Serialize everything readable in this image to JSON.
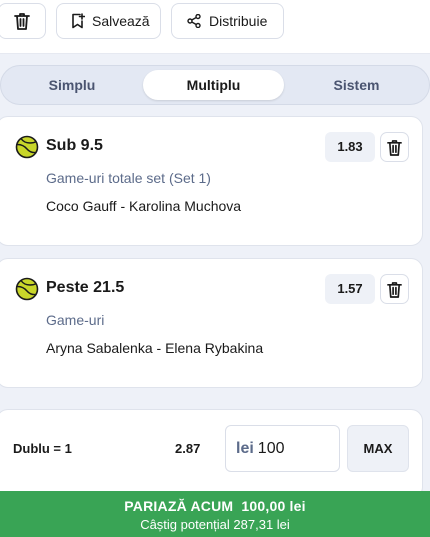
{
  "toolbar": {
    "save_label": "Salvează",
    "share_label": "Distribuie",
    "icons": [
      "trash-icon",
      "bookmark-icon",
      "share-icon"
    ]
  },
  "tabs": [
    {
      "label": "Simplu",
      "active": false
    },
    {
      "label": "Multiplu",
      "active": true
    },
    {
      "label": "Sistem",
      "active": false
    }
  ],
  "selections": [
    {
      "title": "Sub 9.5",
      "odds": "1.83",
      "market": "Game-uri totale set (Set 1)",
      "match": "Coco Gauff - Karolina Muchova",
      "sport_icon": "tennis-ball-icon"
    },
    {
      "title": "Peste 21.5",
      "odds": "1.57",
      "market": "Game-uri",
      "match": "Aryna Sabalenka - Elena Rybakina",
      "sport_icon": "tennis-ball-icon"
    }
  ],
  "stake": {
    "bet_type": "Dublu = 1",
    "total_odds": "2.87",
    "currency": "lei",
    "amount": "100",
    "max_label": "MAX"
  },
  "place_bet": {
    "label": "PARIAZĂ ACUM  100,00 lei",
    "potential_win": "Câștig potențial 287,31 lei"
  },
  "colors": {
    "accent_green": "#39a455",
    "tennis_ball": "#c8d62a",
    "muted_text": "#5c6b8a"
  }
}
